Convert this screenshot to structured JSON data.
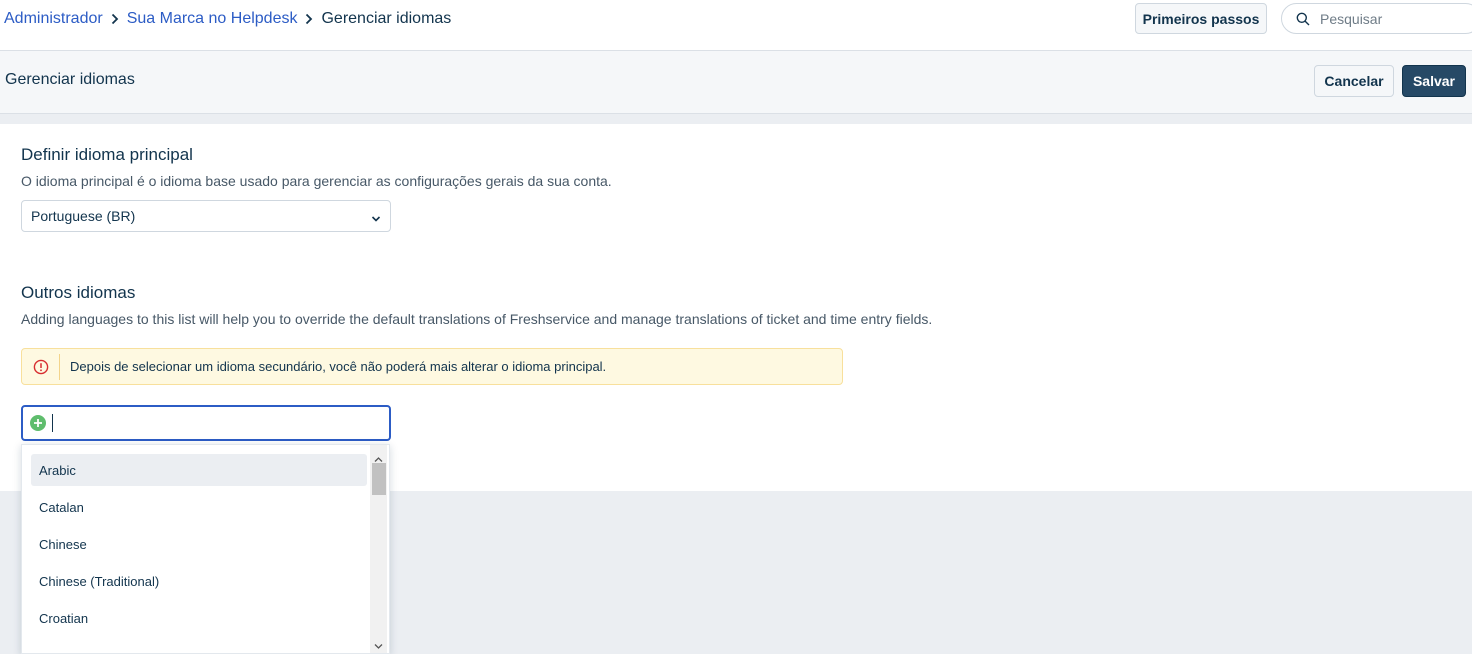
{
  "breadcrumb": {
    "items": [
      "Administrador",
      "Sua Marca no Helpdesk"
    ],
    "current": "Gerenciar idiomas"
  },
  "topbar": {
    "first_steps_label": "Primeiros passos",
    "search_placeholder": "Pesquisar"
  },
  "header": {
    "title": "Gerenciar idiomas",
    "cancel_label": "Cancelar",
    "save_label": "Salvar"
  },
  "primary_language": {
    "title": "Definir idioma principal",
    "description": "O idioma principal é o idioma base usado para gerenciar as configurações gerais da sua conta.",
    "selected": "Portuguese (BR)"
  },
  "other_languages": {
    "title": "Outros idiomas",
    "description": "Adding languages to this list will help you to override the default translations of Freshservice and manage translations of ticket and time entry fields.",
    "warning": "Depois de selecionar um idioma secundário, você não poderá mais alterar o idioma principal.",
    "input_value": "",
    "options": [
      "Arabic",
      "Catalan",
      "Chinese",
      "Chinese (Traditional)",
      "Croatian"
    ],
    "highlighted_option": "Arabic"
  },
  "icons": {
    "breadcrumb_separator": "chevron-right-icon",
    "search": "search-icon",
    "select_arrow": "chevron-down-icon",
    "warning": "alert-circle-icon",
    "add": "plus-circle-icon"
  },
  "colors": {
    "link": "#2c5cc5",
    "primary_button": "#264966",
    "warning_bg": "#fef9e1",
    "warning_icon": "#d72d30",
    "add_icon": "#5fbd6d",
    "focus_border": "#2c5cc5"
  }
}
